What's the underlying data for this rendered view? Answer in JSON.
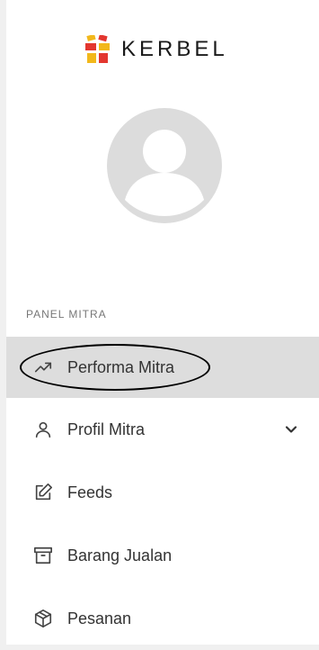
{
  "brand": {
    "name": "KERBEL"
  },
  "sidebar": {
    "section_label": "PANEL MITRA",
    "items": [
      {
        "label": "Performa Mitra",
        "icon": "trending-up-icon",
        "active": true
      },
      {
        "label": "Profil Mitra",
        "icon": "user-icon",
        "has_submenu": true
      },
      {
        "label": "Feeds",
        "icon": "edit-icon"
      },
      {
        "label": "Barang Jualan",
        "icon": "archive-icon"
      },
      {
        "label": "Pesanan",
        "icon": "package-icon"
      }
    ]
  },
  "colors": {
    "active_bg": "#dddddd",
    "logo_red": "#e3372f",
    "logo_yellow": "#f2b81b",
    "avatar_bg": "#dcdcdc"
  }
}
